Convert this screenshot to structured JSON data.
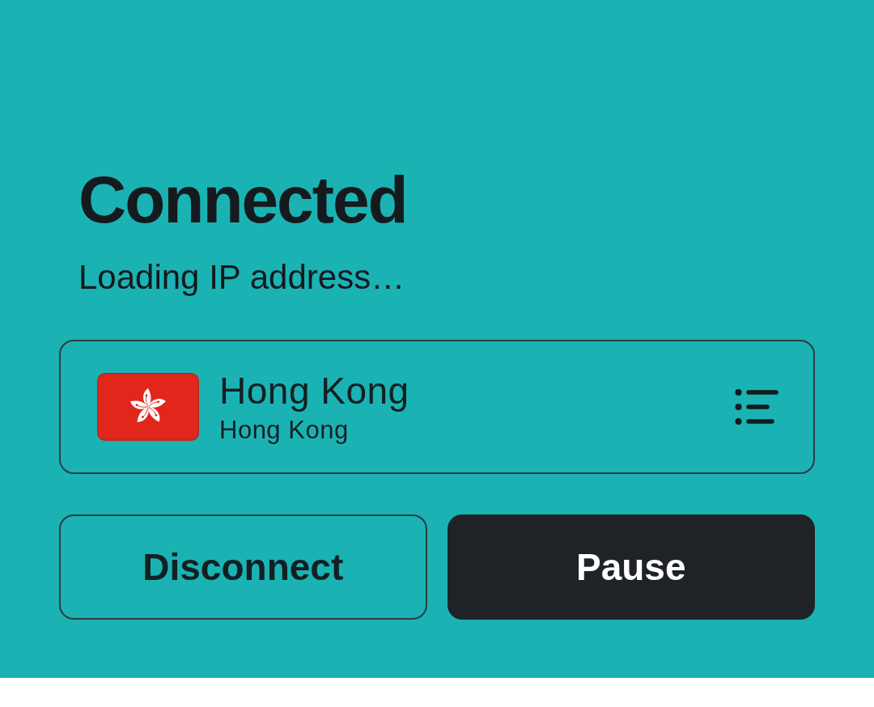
{
  "status": {
    "title": "Connected",
    "subtitle": "Loading IP address…"
  },
  "location": {
    "city": "Hong Kong",
    "region": "Hong Kong"
  },
  "buttons": [
    {
      "label": "Disconnect",
      "kind": "outline"
    },
    {
      "label": "Pause",
      "kind": "filled"
    }
  ]
}
